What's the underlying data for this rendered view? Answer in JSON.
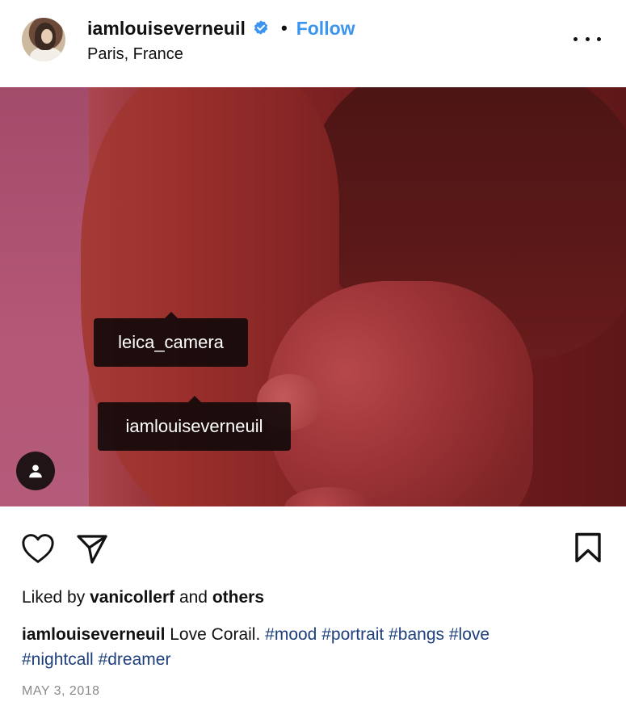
{
  "post": {
    "username": "iamlouiseverneuil",
    "separator": "•",
    "follow_label": "Follow",
    "location": "Paris, France",
    "more_icon": "more-horizontal-icon",
    "verified_icon": "verified-badge-icon",
    "verified_color": "#3b95f0"
  },
  "photo": {
    "tags": [
      {
        "label": "leica_camera"
      },
      {
        "label": "iamlouiseverneuil"
      }
    ],
    "tags_icon": "user-tag-icon"
  },
  "actions": {
    "like_icon": "heart-icon",
    "share_icon": "send-icon",
    "save_icon": "bookmark-icon"
  },
  "likes": {
    "prefix": "Liked by",
    "user": "vanicollerf",
    "middle": "and",
    "others": "others"
  },
  "caption": {
    "user": "iamlouiseverneuil",
    "text": "Love Corail.",
    "hashtags": [
      "#mood",
      "#portrait",
      "#bangs",
      "#love",
      "#nightcall",
      "#dreamer"
    ],
    "hashtag_color": "#1d3f7c"
  },
  "date": "MAY 3, 2018"
}
